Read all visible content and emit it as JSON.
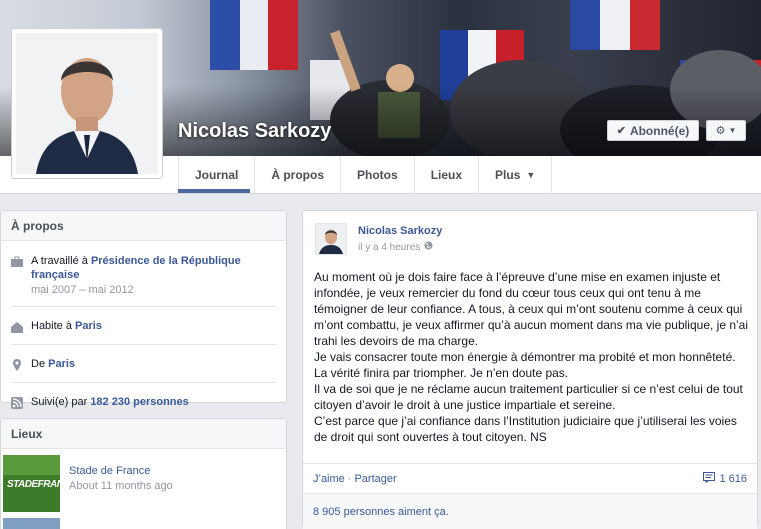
{
  "profile": {
    "name": "Nicolas Sarkozy",
    "subscribed_label": "Abonné(e)"
  },
  "tabs": [
    {
      "label": "Journal"
    },
    {
      "label": "À propos"
    },
    {
      "label": "Photos"
    },
    {
      "label": "Lieux"
    },
    {
      "label": "Plus"
    }
  ],
  "about": {
    "title": "À propos",
    "work_prefix": "A travaillé à",
    "work_place": "Présidence de la République française",
    "work_dates": "mai 2007 – mai 2012",
    "lives_prefix": "Habite à",
    "lives_place": "Paris",
    "from_prefix": "De",
    "from_place": "Paris",
    "followers_prefix": "Suivi(e) par",
    "followers_count": "182 230 personnes"
  },
  "places": {
    "title": "Lieux",
    "items": [
      {
        "thumb_label": "STADEFRANCE",
        "name": "Stade de France",
        "time": "About 11 months ago"
      }
    ]
  },
  "post": {
    "author": "Nicolas Sarkozy",
    "time": "il y a 4 heures",
    "paragraphs": [
      "Au moment où je dois faire face à l’épreuve d’une mise en examen injuste et infondée, je veux remercier du fond du cœur tous ceux qui ont tenu à me témoigner de leur confiance. A tous, à ceux qui m’ont soutenu comme à ceux qui m’ont combattu, je veux affirmer qu’à aucun moment dans ma vie publique, je n’ai trahi les devoirs de ma charge.",
      "Je vais consacrer toute mon énergie à démontrer ma probité et mon honnêteté. La vérité finira par triompher. Je n’en doute pas.",
      "Il va de soi que je ne réclame aucun traitement particulier si ce n’est celui de tout citoyen d’avoir le droit à une justice impartiale et sereine.",
      "C’est parce que j’ai confiance dans l’Institution judiciaire que j’utiliserai les voies de droit qui sont ouvertes à tout citoyen. NS"
    ],
    "like_label": "J’aime",
    "separator": "·",
    "share_label": "Partager",
    "comments_count": "1 616",
    "likes_summary": "8 905 personnes aiment ça."
  },
  "colors": {
    "link": "#3b5998",
    "muted": "#9197a3",
    "tab_active": "#4e69a2"
  }
}
